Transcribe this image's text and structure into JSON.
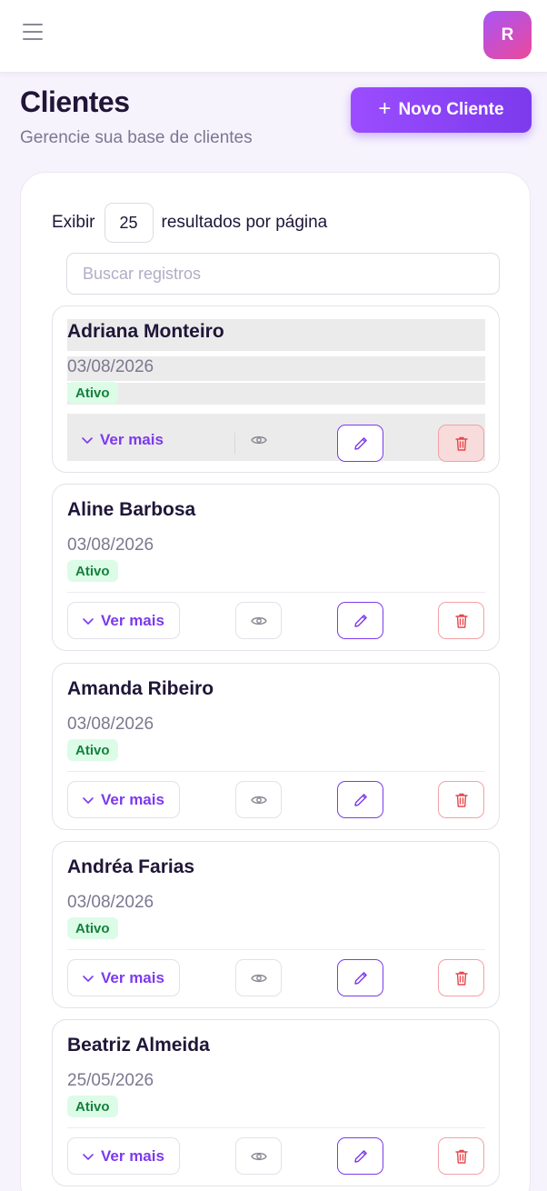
{
  "header": {
    "avatar_initial": "R",
    "icons": {
      "menu": "menu-icon"
    }
  },
  "page": {
    "title": "Clientes",
    "subtitle": "Gerencie sua base de clientes",
    "new_button_label": "Novo Cliente",
    "new_button_icon": "plus-icon"
  },
  "controls": {
    "show_label": "Exibir",
    "per_page_value": "25",
    "per_page_suffix": "resultados por página",
    "search_placeholder": "Buscar registros"
  },
  "colors": {
    "accent": "#7c3aed",
    "status_active_bg": "#dcfce7",
    "status_active_text": "#15803d",
    "danger": "#e5484d"
  },
  "cards": [
    {
      "name": "Adriana Monteiro",
      "date": "03/08/2026",
      "status": "Ativo",
      "more_label": "Ver mais"
    },
    {
      "name": "Aline Barbosa",
      "date": "03/08/2026",
      "status": "Ativo",
      "more_label": "Ver mais"
    },
    {
      "name": "Amanda Ribeiro",
      "date": "03/08/2026",
      "status": "Ativo",
      "more_label": "Ver mais"
    },
    {
      "name": "Andréa Farias",
      "date": "03/08/2026",
      "status": "Ativo",
      "more_label": "Ver mais"
    },
    {
      "name": "Beatriz Almeida",
      "date": "25/05/2026",
      "status": "Ativo",
      "more_label": "Ver mais"
    }
  ]
}
